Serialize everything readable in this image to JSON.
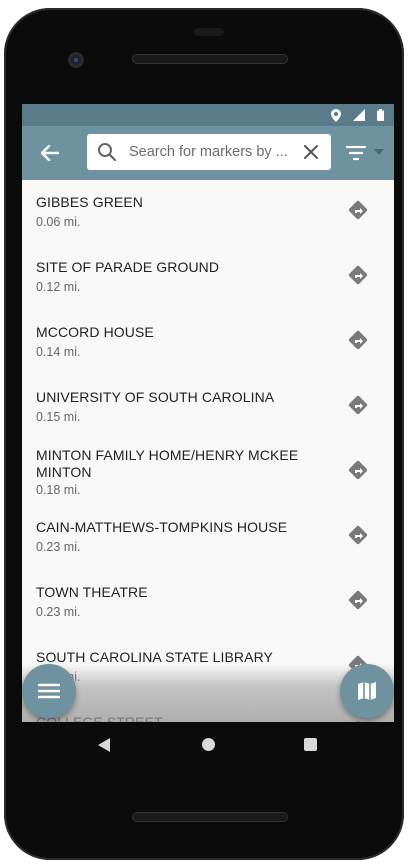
{
  "search": {
    "placeholder": "Search for markers by ..."
  },
  "markers": [
    {
      "name": "GIBBES GREEN",
      "distance": "0.06 mi."
    },
    {
      "name": "SITE OF PARADE GROUND",
      "distance": "0.12 mi."
    },
    {
      "name": "MCCORD HOUSE",
      "distance": "0.14 mi."
    },
    {
      "name": "UNIVERSITY OF SOUTH CAROLINA",
      "distance": "0.15 mi."
    },
    {
      "name": "MINTON FAMILY HOME/HENRY MCKEE MINTON",
      "distance": "0.18 mi."
    },
    {
      "name": "CAIN-MATTHEWS-TOMPKINS HOUSE",
      "distance": "0.23 mi."
    },
    {
      "name": "TOWN THEATRE",
      "distance": "0.23 mi."
    },
    {
      "name": "SOUTH CAROLINA STATE LIBRARY",
      "distance": "0.23 mi."
    },
    {
      "name": "COLLEGE STREET",
      "distance": ""
    }
  ],
  "icons": {
    "back": "back-arrow-icon",
    "search": "search-icon",
    "clear": "close-icon",
    "filter": "filter-icon",
    "directions": "directions-icon",
    "menu": "menu-icon",
    "map": "map-icon"
  },
  "colors": {
    "appbar": "#6f92a0",
    "statusbar": "#5a7c8a",
    "background": "#f8f8f8",
    "fab": "#6f92a0"
  }
}
